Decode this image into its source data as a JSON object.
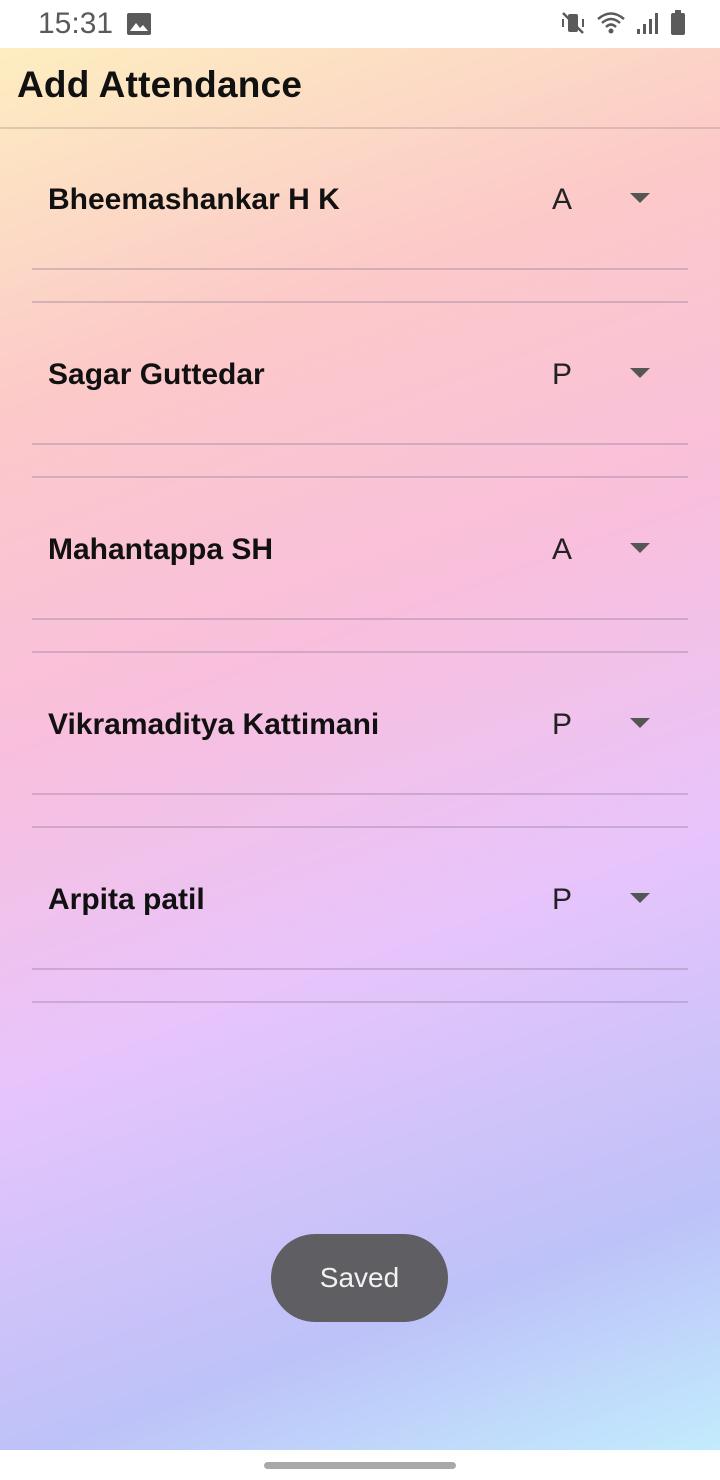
{
  "status_bar": {
    "time": "15:31",
    "icons": [
      "gallery-icon",
      "vibrate-icon",
      "wifi-icon",
      "signal-icon",
      "battery-icon"
    ]
  },
  "app": {
    "title": "Add Attendance"
  },
  "students": [
    {
      "name": "Bheemashankar H K",
      "status": "A"
    },
    {
      "name": "Sagar Guttedar",
      "status": "P"
    },
    {
      "name": "Mahantappa SH",
      "status": "A"
    },
    {
      "name": "Vikramaditya Kattimani",
      "status": "P"
    },
    {
      "name": "Arpita patil",
      "status": "P"
    }
  ],
  "toast": {
    "message": "Saved"
  },
  "colors": {
    "toast_bg": "#5f5e63",
    "gradient_start": "#fdeec0",
    "gradient_mid": "#e8c4fb",
    "gradient_end": "#c2ecfd"
  }
}
